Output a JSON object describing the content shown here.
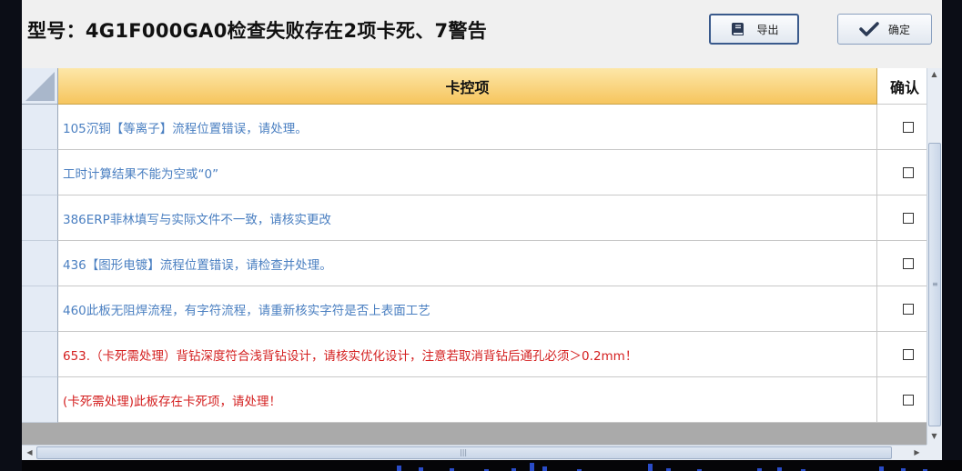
{
  "header": {
    "title": "型号：4G1F000GA0检查失败存在2项卡死、7警告",
    "export_label": "导出",
    "confirm_label": "确定",
    "export_icon": "book-icon",
    "confirm_icon": "checkmark-icon"
  },
  "grid": {
    "columns": [
      "卡控项",
      "确认"
    ],
    "rows": [
      {
        "text": "105沉铜【等离子】流程位置错误，请处理。",
        "color": "#4a7fc1",
        "checked": false
      },
      {
        "text": "工时计算结果不能为空或“0”",
        "color": "#4a7fc1",
        "checked": false
      },
      {
        "text": "386ERP菲林填写与实际文件不一致，请核实更改",
        "color": "#4a7fc1",
        "checked": false
      },
      {
        "text": "436【图形电镀】流程位置错误，请检查并处理。",
        "color": "#4a7fc1",
        "checked": false
      },
      {
        "text": "460此板无阻焊流程，有字符流程，请重新核实字符是否上表面工艺",
        "color": "#4a7fc1",
        "checked": false
      },
      {
        "text": "653.（卡死需处理）背钻深度符合浅背钻设计，请核实优化设计，注意若取消背钻后通孔必须＞0.2mm！",
        "color": "#d42020",
        "checked": false
      },
      {
        "text": "(卡死需处理)此板存在卡死项，请处理！",
        "color": "#d42020",
        "checked": false
      }
    ]
  },
  "colors": {
    "warning_text": "#4a7fc1",
    "blocking_text": "#d42020",
    "header_gradient_top": "#fde7a8",
    "header_gradient_bottom": "#f6c55e"
  }
}
